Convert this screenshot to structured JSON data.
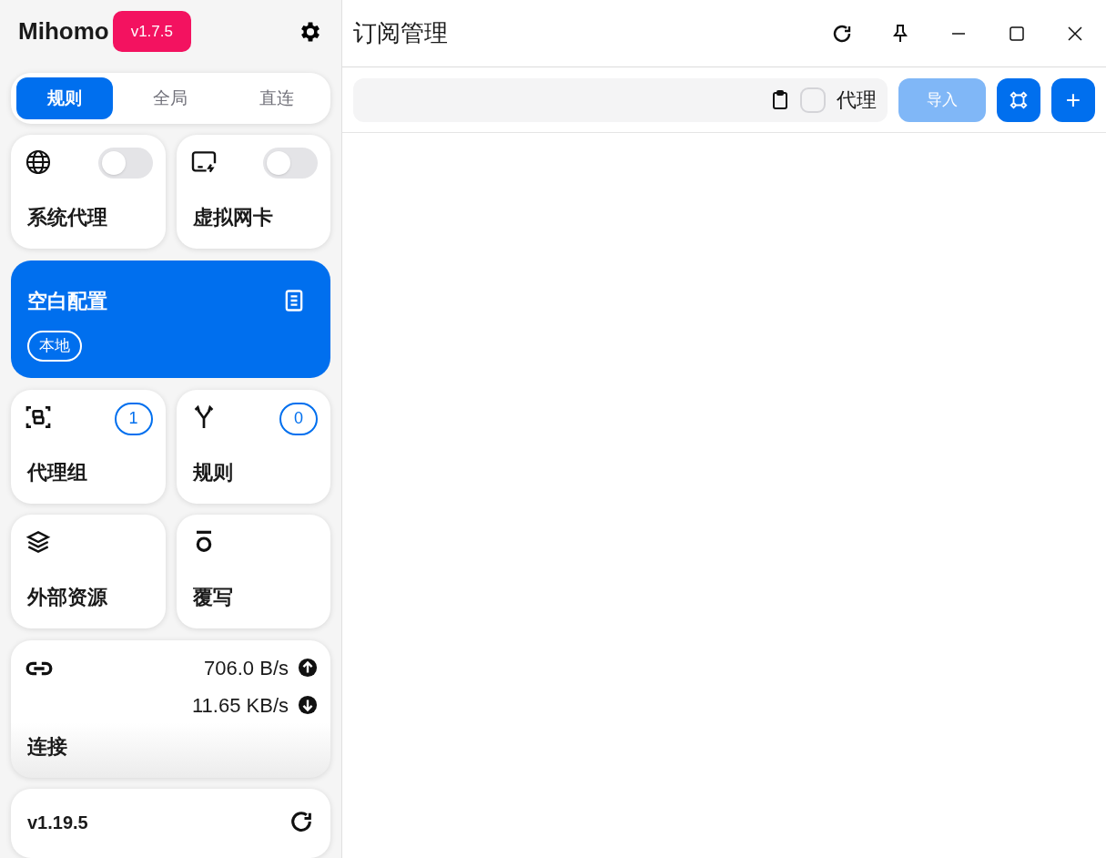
{
  "sidebar": {
    "logo": "Mihomo",
    "version_badge": "v1.7.5",
    "mode_tabs": [
      {
        "label": "规则",
        "selected": true
      },
      {
        "label": "全局",
        "selected": false
      },
      {
        "label": "直连",
        "selected": false
      }
    ],
    "toggle_cards": [
      {
        "kind": "globe",
        "label": "系统代理",
        "on": false
      },
      {
        "kind": "tun",
        "label": "虚拟网卡",
        "on": false
      }
    ],
    "profile_card": {
      "title": "空白配置",
      "tag": "本地",
      "selected": true
    },
    "count_cards": [
      {
        "kind": "group",
        "label": "代理组",
        "count": "1"
      },
      {
        "kind": "rule",
        "label": "规则",
        "count": "0"
      }
    ],
    "nav_cards": [
      {
        "kind": "layers",
        "label": "外部资源"
      },
      {
        "kind": "override",
        "label": "覆写"
      }
    ],
    "connection_card": {
      "label": "连接",
      "upload": "706.0 B/s",
      "download": "11.65 KB/s"
    },
    "core_card": {
      "version": "v1.19.5"
    }
  },
  "main": {
    "title": "订阅管理",
    "toolbar": {
      "proxy_label": "代理",
      "proxy_checked": false,
      "import_label": "导入",
      "import_disabled": true,
      "add_label": "+"
    }
  }
}
